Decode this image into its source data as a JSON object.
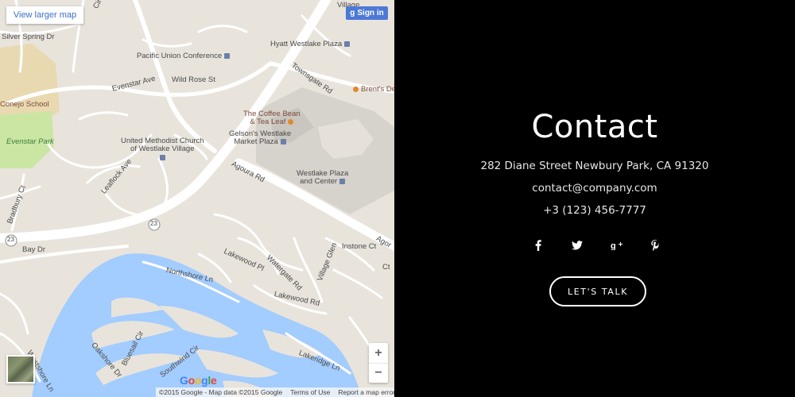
{
  "map": {
    "view_larger": "View larger map",
    "signin": "Sign in",
    "signin_g": "g",
    "zoom_in": "+",
    "zoom_out": "−",
    "google": "Google",
    "footer": {
      "copyright": "©2015 Google - Map data ©2015 Google",
      "terms": "Terms of Use",
      "report": "Report a map error"
    },
    "labels": {
      "silver_spring": "Silver Spring Dr",
      "conejo_school": "Conejo School",
      "evenstar_park": "Evenstar Park",
      "pacific_union": "Pacific Union Conference",
      "hyatt": "Hyatt Westlake Plaza",
      "village": "Village",
      "evenstar_ave": "Evenstar Ave",
      "wild_rose": "Wild Rose St",
      "townsgate": "Townsgate Rd",
      "brents": "Brent's De",
      "coffee_bean_1": "The Coffee Bean",
      "coffee_bean_2": "& Tea Leaf",
      "methodist_1": "United Methodist Church",
      "methodist_2": "of Westlake Village",
      "gelsons_1": "Gelson's Westlake",
      "gelsons_2": "Market Plaza",
      "agoura": "Agoura Rd",
      "westlake_plaza_1": "Westlake Plaza",
      "westlake_plaza_2": "and Center",
      "leaflock": "Leaflock Ave",
      "bradbury": "Bradbury Ct",
      "route_23a": "23",
      "route_23b": "23",
      "bay_dr": "Bay Dr",
      "lakewood_pl": "Lakewood Pl",
      "watergate": "Watergate Rd",
      "village_glen": "Village Glen",
      "instone": "Instone Ct",
      "northshore": "Northshore Ln",
      "lakewood_rd": "Lakewood Rd",
      "bluesail": "Bluesail Cir",
      "oakshore": "Oakshore Dr",
      "southwind": "Southwind Cir",
      "lakeridge": "Lakeridge Ln",
      "westshore": "Westshore Ln",
      "agoura_edge": "Agor",
      "edge_ct": "Ct",
      "edge_cir": "Cir"
    }
  },
  "contact": {
    "title": "Contact",
    "address": "282 Diane Street Newbury Park, CA 91320",
    "email": "contact@company.com",
    "phone": "+3 (123) 456-7777",
    "socials": [
      {
        "name": "facebook-icon",
        "glyph": "f"
      },
      {
        "name": "twitter-icon",
        "glyph": ""
      },
      {
        "name": "google-plus-icon",
        "glyph": "g+"
      },
      {
        "name": "pinterest-icon",
        "glyph": "p"
      }
    ],
    "cta": "LET'S TALK"
  },
  "colors": {
    "map_land": "#e8e4dc",
    "map_water": "#a3ccff",
    "map_road": "#ffffff",
    "map_park": "#cbe6a3",
    "map_campus": "#e9d9b1",
    "map_building": "#d6d2cc",
    "link_blue": "#3b6fc8",
    "signin_blue": "#4d79d6",
    "contact_bg": "#000000",
    "contact_text": "#ffffff"
  }
}
